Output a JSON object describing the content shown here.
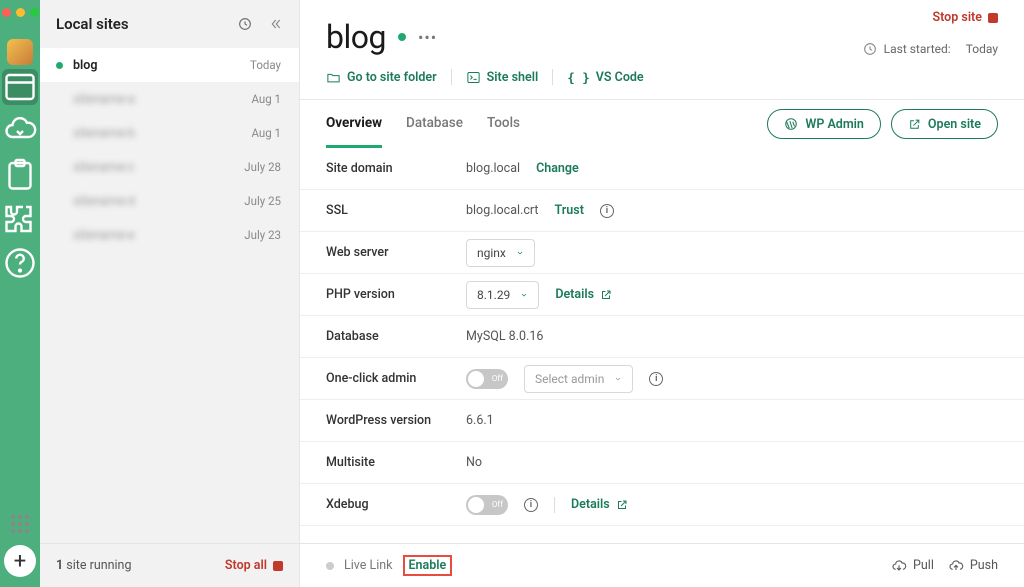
{
  "rail": {
    "icons": [
      "avatar",
      "browser",
      "cloud-sync",
      "clipboard",
      "puzzle",
      "help"
    ]
  },
  "sidebar": {
    "title": "Local sites",
    "sites": [
      {
        "name": "blog",
        "date": "Today",
        "running": true,
        "active": true
      },
      {
        "name": "sitename-a",
        "date": "Aug 1",
        "running": false,
        "active": false,
        "redacted": true
      },
      {
        "name": "sitename-b",
        "date": "Aug 1",
        "running": false,
        "active": false,
        "redacted": true
      },
      {
        "name": "sitename-c",
        "date": "July 28",
        "running": false,
        "active": false,
        "redacted": true
      },
      {
        "name": "sitename-d",
        "date": "July 25",
        "running": false,
        "active": false,
        "redacted": true
      },
      {
        "name": "sitename-e",
        "date": "July 23",
        "running": false,
        "active": false,
        "redacted": true
      }
    ],
    "footer": {
      "running_count": "1",
      "running_label": " site running",
      "stop_all": "Stop all"
    }
  },
  "header": {
    "stop_site": "Stop site",
    "title": "blog",
    "last_started_label": "Last started:",
    "last_started_value": "Today",
    "quick_links": {
      "folder": "Go to site folder",
      "shell": "Site shell",
      "vscode": "VS Code"
    }
  },
  "tabs": {
    "overview": "Overview",
    "database": "Database",
    "tools": "Tools"
  },
  "actions": {
    "wp_admin": "WP Admin",
    "open_site": "Open site"
  },
  "details": {
    "site_domain": {
      "label": "Site domain",
      "value": "blog.local",
      "action": "Change"
    },
    "ssl": {
      "label": "SSL",
      "value": "blog.local.crt",
      "action": "Trust"
    },
    "web_server": {
      "label": "Web server",
      "value": "nginx"
    },
    "php_version": {
      "label": "PHP version",
      "value": "8.1.29",
      "action": "Details"
    },
    "database": {
      "label": "Database",
      "value": "MySQL 8.0.16"
    },
    "one_click_admin": {
      "label": "One-click admin",
      "toggle": "Off",
      "select_placeholder": "Select admin"
    },
    "wp_version": {
      "label": "WordPress version",
      "value": "6.6.1"
    },
    "multisite": {
      "label": "Multisite",
      "value": "No"
    },
    "xdebug": {
      "label": "Xdebug",
      "toggle": "Off",
      "action": "Details"
    }
  },
  "footer": {
    "live_link_label": "Live Link",
    "enable": "Enable",
    "pull": "Pull",
    "push": "Push"
  }
}
